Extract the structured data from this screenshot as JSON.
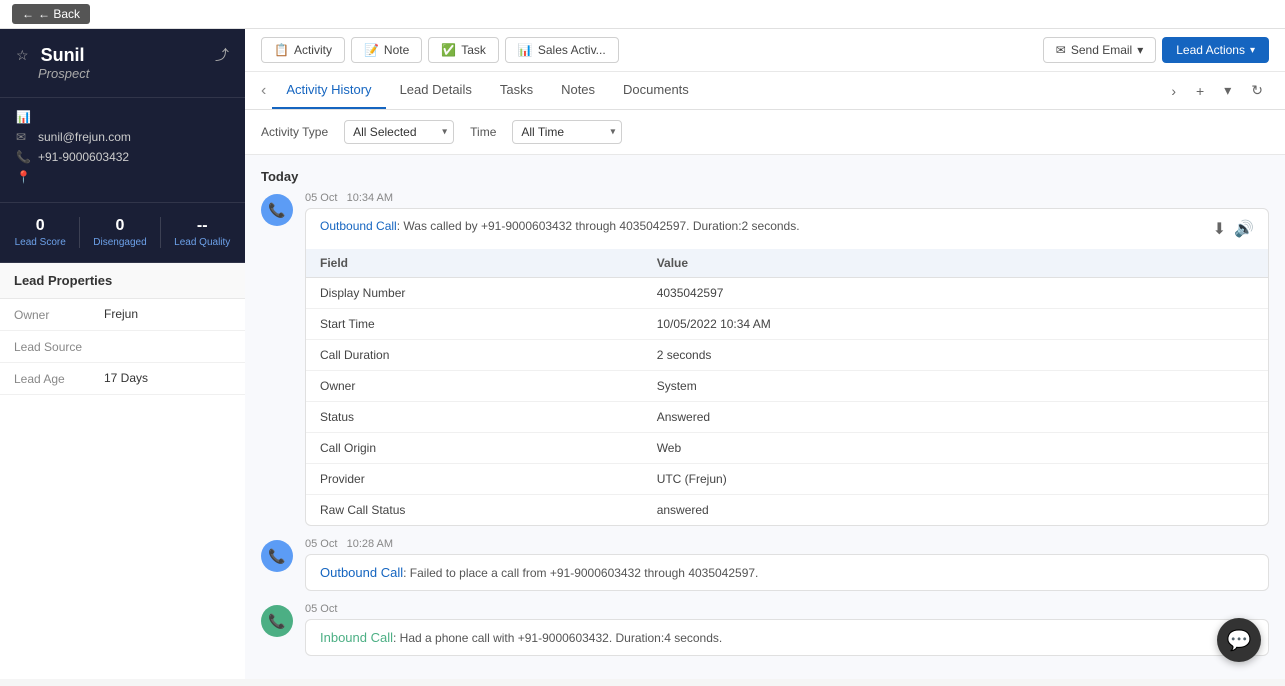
{
  "topbar": {
    "back_label": "← Back"
  },
  "lead": {
    "name": "Sunil",
    "title": "Prospect",
    "email": "sunil@frejun.com",
    "phone": "+91-9000603432",
    "lead_score": "0",
    "lead_score_label": "Lead Score",
    "disengaged": "0",
    "disengaged_label": "Disengaged",
    "lead_quality": "--",
    "lead_quality_label": "Lead Quality"
  },
  "lead_properties": {
    "title": "Lead Properties",
    "rows": [
      {
        "label": "Owner",
        "value": "Frejun"
      },
      {
        "label": "Lead Source",
        "value": ""
      },
      {
        "label": "Lead Age",
        "value": "17 Days"
      }
    ]
  },
  "action_bar": {
    "buttons": [
      {
        "icon": "📋",
        "label": "Activity"
      },
      {
        "icon": "📝",
        "label": "Note"
      },
      {
        "icon": "✅",
        "label": "Task"
      },
      {
        "icon": "📊",
        "label": "Sales Activ..."
      }
    ],
    "send_email": "Send Email",
    "lead_actions": "Lead Actions"
  },
  "tabs": [
    {
      "label": "Activity History",
      "active": true
    },
    {
      "label": "Lead Details",
      "active": false
    },
    {
      "label": "Tasks",
      "active": false
    },
    {
      "label": "Notes",
      "active": false
    },
    {
      "label": "Documents",
      "active": false
    }
  ],
  "filters": {
    "activity_type_label": "Activity Type",
    "activity_type_value": "All Selected",
    "time_label": "Time",
    "time_value": "All Time"
  },
  "activities": {
    "today_label": "Today",
    "items": [
      {
        "date": "05 Oct",
        "time": "10:34 AM",
        "type": "outbound",
        "link_label": "Outbound Call",
        "description": ": Was called by +91-9000603432 through 4035042597. Duration:2 seconds.",
        "expanded": true,
        "fields": [
          {
            "field": "Display Number",
            "value": "4035042597"
          },
          {
            "field": "Start Time",
            "value": "10/05/2022 10:34 AM"
          },
          {
            "field": "Call Duration",
            "value": "2 seconds"
          },
          {
            "field": "Owner",
            "value": "System"
          },
          {
            "field": "Status",
            "value": "Answered"
          },
          {
            "field": "Call Origin",
            "value": "Web"
          },
          {
            "field": "Provider",
            "value": "UTC (Frejun)"
          },
          {
            "field": "Raw Call Status",
            "value": "answered"
          }
        ]
      },
      {
        "date": "05 Oct",
        "time": "10:28 AM",
        "type": "outbound",
        "link_label": "Outbound Call",
        "description": ": Failed to place a call from +91-9000603432 through 4035042597.",
        "expanded": false
      },
      {
        "date": "05 Oct",
        "time": "",
        "type": "inbound",
        "link_label": "Inbound Call",
        "description": ": Had a phone call with +91-9000603432. Duration:4 seconds.",
        "expanded": false
      }
    ],
    "table_headers": {
      "field": "Field",
      "value": "Value"
    }
  },
  "icons": {
    "phone": "📞",
    "email": "✉",
    "location": "📍",
    "bar_chart": "📊",
    "star": "☆",
    "share": "⤴",
    "back_arrow": "←",
    "chevron_left": "‹",
    "chevron_right": "›",
    "plus": "+",
    "refresh": "↻",
    "download": "⬇",
    "speaker": "🔊",
    "chat": "💬",
    "down_arrow": "▾"
  }
}
